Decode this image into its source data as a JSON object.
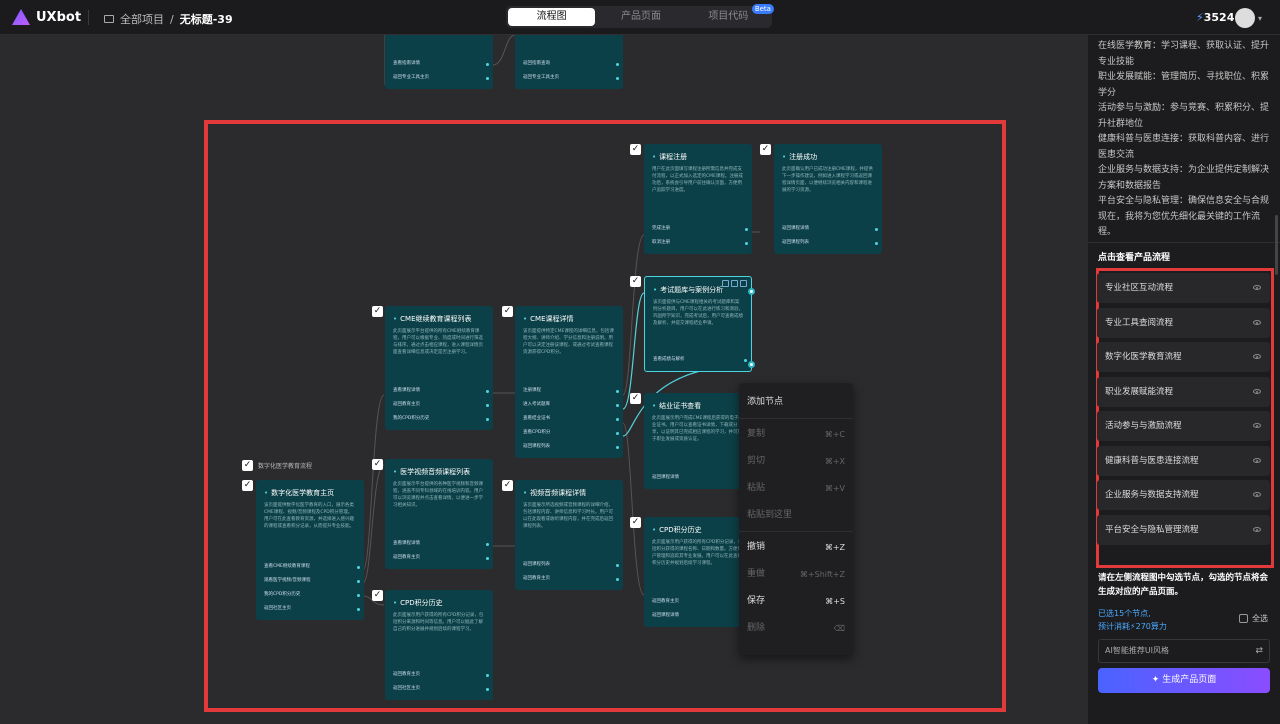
{
  "app": {
    "logo": "UXbot"
  },
  "breadcrumb": {
    "root": "全部项目",
    "sep": "/",
    "current": "无标题-39"
  },
  "tabs": [
    {
      "label": "流程图",
      "active": true
    },
    {
      "label": "产品页面",
      "active": false
    },
    {
      "label": "项目代码",
      "active": false,
      "badge": "Beta"
    }
  ],
  "energy": {
    "value": "3524"
  },
  "canvas": {
    "top_nodes": [
      {
        "actions": [
          "查看指南详情",
          "返回专业工具主页"
        ]
      },
      {
        "actions": [
          "返回指南查询",
          "返回专业工具主页"
        ]
      }
    ],
    "group_label": "数字化医学教育流程",
    "nodes": [
      {
        "title": "数字化医学教育主页",
        "desc": "该页面提供数字化医学教育的入口，展示各类CME课程、视频/音频课程及CPD积分管理。用户可在此查看教育资源，并选择进入感兴趣的课程或查看积分记录，从而提升专业技能。",
        "actions": [
          "查看CME继续教育课程",
          "观看医学视频/音频课程",
          "我的CPD积分历史",
          "返回社区主页"
        ]
      },
      {
        "title": "CME继续教育课程列表",
        "desc": "此页面展示平台提供的所有CME继续教育课程，用户可以根据专业、热度或时间进行筛选与排序。通过点击相应课程，进入课程详情页面查看详细信息或决定是否注册学习。",
        "actions": [
          "查看课程详情",
          "返回教育主页",
          "我的CPD积分历史"
        ]
      },
      {
        "title": "医学视频音频课程列表",
        "desc": "此页面展示平台提供的各种医学视频和音频课程，涵盖不同专科领域的在线培训内容。用户可以浏览课程并点击查看详情，以便进一步学习相关知识。",
        "actions": [
          "查看课程详情",
          "返回教育主页"
        ]
      },
      {
        "title": "CPD积分历史",
        "desc": "此页面展示用户获得的所有CPD积分记录，包括积分来源和时间等信息。用户可以据此了解自己的积分进展并规划后续的课程学习。",
        "actions": [
          "返回教育主页",
          "返回社区主页"
        ]
      },
      {
        "title": "CME课程详情",
        "desc": "该页面提供特定CME课程的详细信息，包括课程大纲、讲师介绍、学分信息和注册说明。用户可以决定注册该课程，或通过考试查看课程资源获得CPD积分。",
        "actions": [
          "注册课程",
          "进入考试题库",
          "查看结业证书",
          "查看CPD积分",
          "返回课程列表"
        ]
      },
      {
        "title": "视频音频课程详情",
        "desc": "该页面展示所选视频或音频课程的详细介绍，包括课程内容、讲师信息和学习时长。用户可以在此观看或收听课程内容，并在完成后返回课程列表。",
        "actions": [
          "返回课程列表",
          "返回教育主页"
        ]
      },
      {
        "title": "课程注册",
        "desc": "用户在此页面填写课程注册所需信息并完成支付流程，以正式加入选定的CME课程。注册成功后，系统会引导用户前往确认页面，方便用户追踪学习进度。",
        "actions": [
          "完成注册",
          "取消注册"
        ]
      },
      {
        "title": "注册成功",
        "desc": "此页面确认用户已成功注册CME课程，并提供下一步操作建议，例如进入课程学习或返回课程详情页面，以便继续浏览相关内容和课程进展的学习资源。",
        "actions": [
          "返回课程详情",
          "返回课程列表"
        ]
      },
      {
        "title": "考试题库与案例分析",
        "desc": "该页面提供与CME课程相关的考试题库和案例分析题目，用户可以在此进行练习和测验，巩固所学知识，完成考试后，用户可查看成绩及解析，并提交课程结业申请。",
        "actions": [
          "查看成绩与解析"
        ]
      },
      {
        "title": "结业证书查看",
        "desc": "此页面展示用户完成CME课程后获得的电子结业证书。用户可以查看证书详情，下载或分享，以证明其已完成相应课程的学习，并可用于职业发展或资质认证。",
        "actions": [
          "返回课程详情"
        ]
      },
      {
        "title": "CPD积分历史",
        "desc": "此页面展示用户获得的所有CPD积分记录，包括积分获得的课程名称、日期和数量。方便用户管理和追踪其专业发展。用户可以在此查看积分历史并规划后续学习课程。",
        "actions": [
          "返回教育主页",
          "返回课程详情"
        ]
      }
    ]
  },
  "context_menu": {
    "items": [
      {
        "label": "添加节点",
        "key": "",
        "on": true
      },
      {
        "label": "复制",
        "key": "⌘+C",
        "on": false
      },
      {
        "label": "剪切",
        "key": "⌘+X",
        "on": false
      },
      {
        "label": "粘贴",
        "key": "⌘+V",
        "on": false
      },
      {
        "label": "粘贴到这里",
        "key": "",
        "on": false
      },
      {
        "label": "撤销",
        "key": "⌘+Z",
        "on": true
      },
      {
        "label": "重做",
        "key": "⌘+Shift+Z",
        "on": false
      },
      {
        "label": "保存",
        "key": "⌘+S",
        "on": true
      },
      {
        "label": "删除",
        "key": "⌫",
        "on": false
      }
    ]
  },
  "panel": {
    "intro_lines": [
      "在线医学教育：学习课程、获取认证、提升专业技能",
      "职业发展赋能：管理简历、寻找职位、积累学分",
      "活动参与与激励：参与竞赛、积累积分、提升社群地位",
      "健康科普与医患连接：获取科普内容、进行医患交流",
      "企业服务与数据支持：为企业提供定制解决方案和数据报告",
      "平台安全与隐私管理：确保信息安全与合规现在，我将为您优先细化最关键的工作流程。"
    ],
    "flows_title": "点击查看产品流程",
    "flows": [
      "专业社区互动流程",
      "专业工具查阅流程",
      "数字化医学教育流程",
      "职业发展赋能流程",
      "活动参与与激励流程",
      "健康科普与医患连接流程",
      "企业服务与数据支持流程",
      "平台安全与隐私管理流程"
    ],
    "hint": "请在左侧流程图中勾选节点，勾选的节点将会生成对应的产品页面。",
    "selected": "已选15个节点,",
    "cost": "预计消耗⚡270算力",
    "select_all": "全选",
    "style_placeholder": "AI智能推荐UI风格",
    "generate": "生成产品页面"
  }
}
